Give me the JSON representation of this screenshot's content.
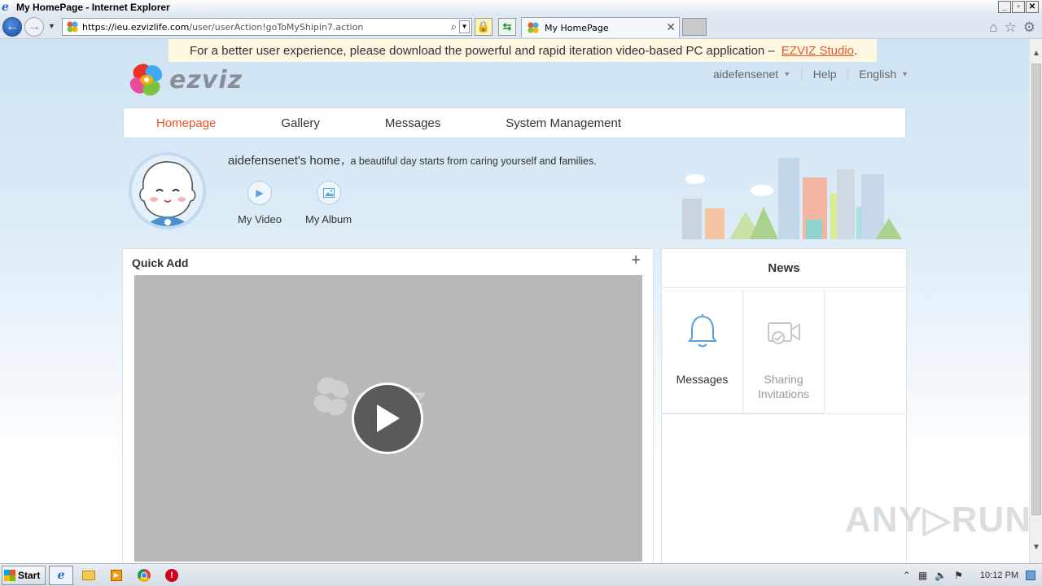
{
  "window": {
    "title": "My HomePage - Internet Explorer",
    "controls": [
      "_",
      "▫",
      "✕"
    ]
  },
  "browser": {
    "url_host": "https://ieu.ezvizlife.com",
    "url_path": "/user/userAction!goToMyShipin7.action",
    "tab_title": "My HomePage"
  },
  "notice": {
    "text": "For a better user experience, please download the powerful and rapid iteration video-based PC application –",
    "link": "EZVIZ Studio",
    "end": "."
  },
  "header": {
    "logo_text": "ezviz",
    "username": "aidefensenet",
    "help": "Help",
    "language": "English"
  },
  "nav": {
    "items": [
      {
        "label": "Homepage",
        "active": true
      },
      {
        "label": "Gallery",
        "active": false
      },
      {
        "label": "Messages",
        "active": false
      },
      {
        "label": "System Management",
        "active": false
      }
    ]
  },
  "profile": {
    "home_title": "aidefensenet's home",
    "tagline": "，a beautiful day starts from caring yourself and families.",
    "my_video": "My Video",
    "my_album": "My Album"
  },
  "quick_add": {
    "title": "Quick Add",
    "plus": "+",
    "watermark": "ezviz"
  },
  "news": {
    "title": "News",
    "messages": "Messages",
    "sharing_line1": "Sharing",
    "sharing_line2": "Invitations"
  },
  "overlay": {
    "watermark": "ANY▷RUN"
  },
  "taskbar": {
    "start": "Start",
    "clock": "10:12 PM"
  },
  "colors": {
    "accent": "#e8562a",
    "link_blue": "#5aa1d7",
    "video_bg": "#b8b8b8"
  }
}
